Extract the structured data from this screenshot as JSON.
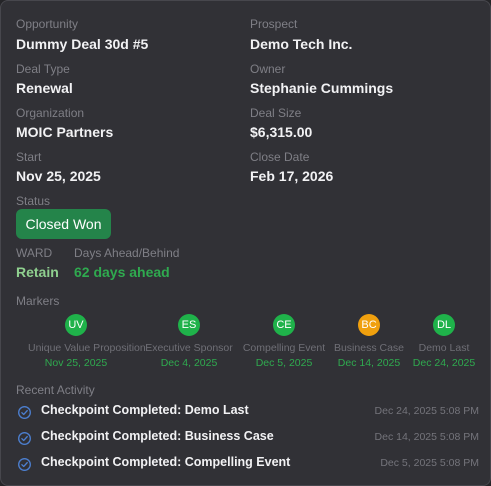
{
  "fields": {
    "opportunity": {
      "label": "Opportunity",
      "value": "Dummy Deal 30d #5"
    },
    "prospect": {
      "label": "Prospect",
      "value": "Demo Tech Inc."
    },
    "deal_type": {
      "label": "Deal Type",
      "value": "Renewal"
    },
    "owner": {
      "label": "Owner",
      "value": "Stephanie Cummings"
    },
    "organization": {
      "label": "Organization",
      "value": "MOIC Partners"
    },
    "deal_size": {
      "label": "Deal Size",
      "value": "$6,315.00"
    },
    "start": {
      "label": "Start",
      "value": "Nov 25, 2025"
    },
    "close_date": {
      "label": "Close Date",
      "value": "Feb 17, 2026"
    }
  },
  "status": {
    "label": "Status",
    "value": "Closed Won",
    "color": "#24844a"
  },
  "ward": {
    "label": "WARD",
    "value": "Retain",
    "color": "#8fd08f"
  },
  "days": {
    "label": "Days Ahead/Behind",
    "value": "62 days ahead",
    "color": "#2faa4f"
  },
  "markers": {
    "label": "Markers",
    "items": [
      {
        "abbr": "UV",
        "name": "Unique Value Proposition",
        "date": "Nov 25, 2025",
        "color": "#1fb24a"
      },
      {
        "abbr": "ES",
        "name": "Executive Sponsor",
        "date": "Dec 4, 2025",
        "color": "#1fb24a"
      },
      {
        "abbr": "CE",
        "name": "Compelling Event",
        "date": "Dec 5, 2025",
        "color": "#1fb24a"
      },
      {
        "abbr": "BC",
        "name": "Business Case",
        "date": "Dec 14, 2025",
        "color": "#f0a00e"
      },
      {
        "abbr": "DL",
        "name": "Demo Last",
        "date": "Dec 24, 2025",
        "color": "#1fb24a"
      }
    ]
  },
  "activity": {
    "label": "Recent Activity",
    "icon": "check-circle-icon",
    "items": [
      {
        "title": "Checkpoint Completed: Demo Last",
        "time": "Dec 24, 2025 5:08 PM"
      },
      {
        "title": "Checkpoint Completed: Business Case",
        "time": "Dec 14, 2025 5:08 PM"
      },
      {
        "title": "Checkpoint Completed: Compelling Event",
        "time": "Dec 5, 2025 5:08 PM"
      }
    ]
  }
}
